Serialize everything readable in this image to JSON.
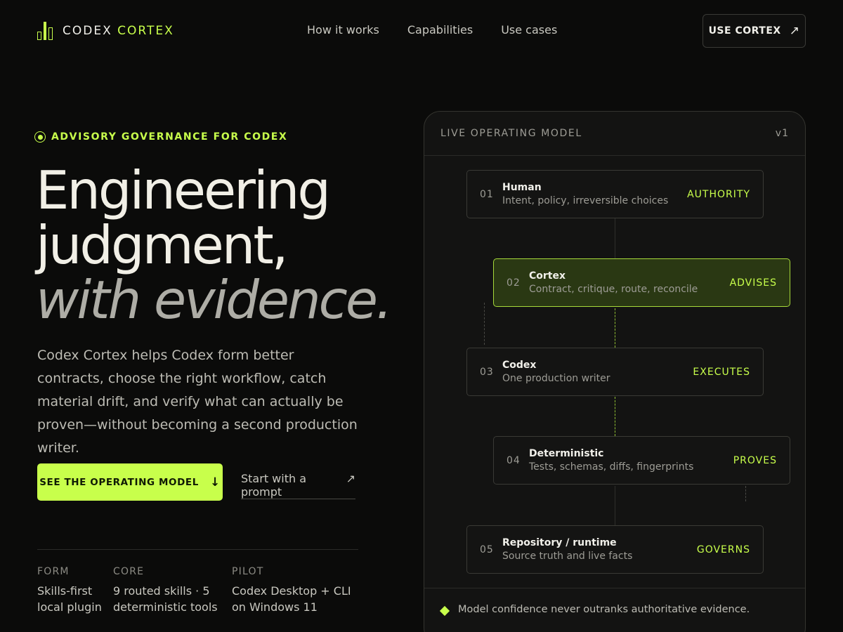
{
  "header": {
    "brand_primary": "CODEX",
    "brand_accent": "CORTEX",
    "nav": [
      "How it works",
      "Capabilities",
      "Use cases"
    ],
    "cta_label": "USE CORTEX",
    "cta_arrow": "↗"
  },
  "hero": {
    "eyebrow": "ADVISORY GOVERNANCE FOR CODEX",
    "headline_line1": "Engineering",
    "headline_line2": "judgment,",
    "headline_line3": "with evidence.",
    "lede": "Codex Cortex helps Codex form better contracts, choose the right workflow, catch material drift, and verify what can actually be proven—without becoming a second production writer.",
    "primary_button": "SEE THE OPERATING MODEL",
    "primary_arrow": "↓",
    "secondary_link": "Start with a prompt",
    "secondary_arrow": "↗"
  },
  "stats": [
    {
      "label": "FORM",
      "value": "Skills-first local plugin"
    },
    {
      "label": "CORE",
      "value": "9 routed skills · 5 deterministic tools"
    },
    {
      "label": "PILOT",
      "value": "Codex Desktop + CLI on Windows 11"
    }
  ],
  "model": {
    "title": "LIVE OPERATING MODEL",
    "version": "v1",
    "nodes": [
      {
        "num": "01",
        "name": "Human",
        "desc": "Intent, policy, irreversible choices",
        "tag": "AUTHORITY"
      },
      {
        "num": "02",
        "name": "Cortex",
        "desc": "Contract, critique, route, reconcile",
        "tag": "ADVISES"
      },
      {
        "num": "03",
        "name": "Codex",
        "desc": "One production writer",
        "tag": "EXECUTES"
      },
      {
        "num": "04",
        "name": "Deterministic",
        "desc": "Tests, schemas, diffs, fingerprints",
        "tag": "PROVES"
      },
      {
        "num": "05",
        "name": "Repository / runtime",
        "desc": "Source truth and live facts",
        "tag": "GOVERNS"
      }
    ],
    "footer": "Model confidence never outranks authoritative evidence."
  },
  "colors": {
    "accent": "#c8ff4b",
    "background": "#0b0b0a",
    "panel": "#131312",
    "active_node": "#2a3813"
  },
  "icons": {
    "logo": "bar-chart-logo-icon",
    "eyebrow": "radio-dot-icon",
    "footer": "diamond-icon"
  }
}
